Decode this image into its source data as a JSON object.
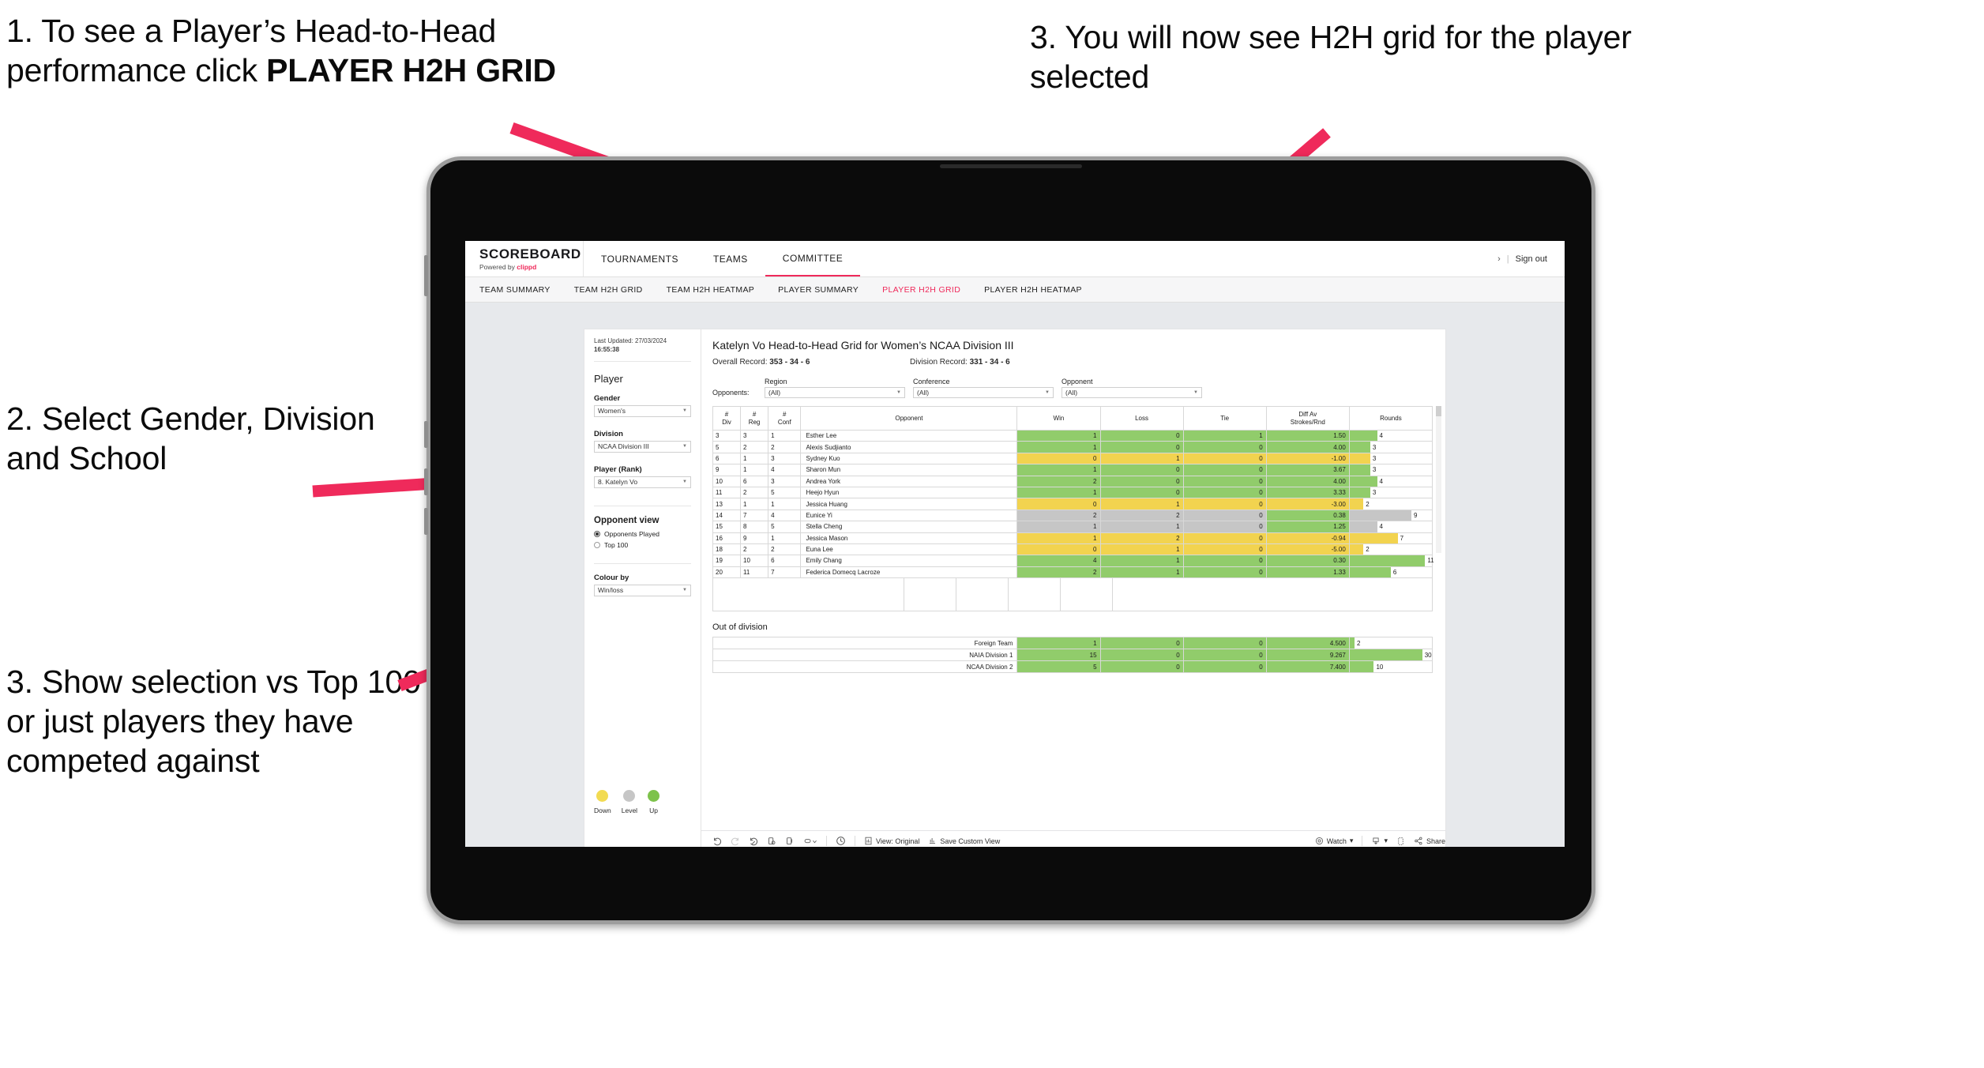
{
  "annotations": {
    "step1_prefix": "1. To see a Player’s Head-to-Head performance click ",
    "step1_bold": "PLAYER H2H GRID",
    "step2": "2. Select Gender, Division and School",
    "step3_left": "3. Show selection vs Top 100 or just players they have competed against",
    "step3_right": "3. You will now see H2H grid for the player selected",
    "arrow_color": "#EF2A5B"
  },
  "app": {
    "logo": {
      "title": "SCOREBOARD",
      "powered_prefix": "Powered by ",
      "brand": "clippd"
    },
    "topnav": [
      {
        "label": "TOURNAMENTS",
        "active": false
      },
      {
        "label": "TEAMS",
        "active": false
      },
      {
        "label": "COMMITTEE",
        "active": true
      }
    ],
    "topnav_right": {
      "chevron": "›",
      "divider": "|",
      "sign_out": "Sign out"
    },
    "subnav": [
      {
        "label": "TEAM SUMMARY",
        "active": false
      },
      {
        "label": "TEAM H2H GRID",
        "active": false
      },
      {
        "label": "TEAM H2H HEATMAP",
        "active": false
      },
      {
        "label": "PLAYER SUMMARY",
        "active": false
      },
      {
        "label": "PLAYER H2H GRID",
        "active": true
      },
      {
        "label": "PLAYER H2H HEATMAP",
        "active": false
      }
    ],
    "accent": "#EF2A5B"
  },
  "pane": {
    "last_updated_label": "Last Updated: 27/03/2024",
    "last_updated_time": "16:55:38",
    "heading": "Player",
    "filters": [
      {
        "label": "Gender",
        "value": "Women's"
      },
      {
        "label": "Division",
        "value": "NCAA Division III"
      },
      {
        "label": "Player (Rank)",
        "value": "8. Katelyn Vo"
      }
    ],
    "opponent_view": {
      "heading": "Opponent view",
      "options": [
        {
          "label": "Opponents Played",
          "selected": true
        },
        {
          "label": "Top 100",
          "selected": false
        }
      ]
    },
    "colour_by": {
      "label": "Colour by",
      "value": "Win/loss"
    },
    "legend": [
      {
        "label": "Down",
        "color": "#F2DB52"
      },
      {
        "label": "Level",
        "color": "#C6C6C6"
      },
      {
        "label": "Up",
        "color": "#7DC24B"
      }
    ]
  },
  "view": {
    "title": "Katelyn Vo Head-to-Head Grid for Women’s NCAA Division III",
    "overall_label": "Overall Record: ",
    "overall_value": "353 - 34 - 6",
    "division_label": "Division Record: ",
    "division_value": "331 - 34 - 6",
    "opponents_label": "Opponents:",
    "opponent_filters": [
      {
        "caption": "Region",
        "value": "(All)"
      },
      {
        "caption": "Conference",
        "value": "(All)"
      },
      {
        "caption": "Opponent",
        "value": "(All)"
      }
    ]
  },
  "chart_data": {
    "type": "table",
    "title": "Katelyn Vo Head-to-Head Grid for Women’s NCAA Division III",
    "columns": [
      "# Div",
      "# Reg",
      "# Conf",
      "Opponent",
      "Win",
      "Loss",
      "Tie",
      "Diff Av Strokes/Rnd",
      "Rounds"
    ],
    "column_lines": [
      [
        "#",
        "Div"
      ],
      [
        "#",
        "Reg"
      ],
      [
        "#",
        "Conf"
      ],
      [
        "Opponent"
      ],
      [
        "Win"
      ],
      [
        "Loss"
      ],
      [
        "Tie"
      ],
      [
        "Diff Av",
        "Strokes/Rnd"
      ],
      [
        "Rounds"
      ]
    ],
    "rounds_max": 12,
    "rows": [
      {
        "div": "3",
        "reg": "3",
        "conf": "1",
        "opponent": "Esther Lee",
        "win": "1",
        "loss": "0",
        "tie": "1",
        "diff": "1.50",
        "rounds": "4",
        "rounds_num": 4,
        "color": "#91CC6B"
      },
      {
        "div": "5",
        "reg": "2",
        "conf": "2",
        "opponent": "Alexis Sudjianto",
        "win": "1",
        "loss": "0",
        "tie": "0",
        "diff": "4.00",
        "rounds": "3",
        "rounds_num": 3,
        "color": "#91CC6B"
      },
      {
        "div": "6",
        "reg": "1",
        "conf": "3",
        "opponent": "Sydney Kuo",
        "win": "0",
        "loss": "1",
        "tie": "0",
        "diff": "-1.00",
        "rounds": "3",
        "rounds_num": 3,
        "color": "#F2D34F"
      },
      {
        "div": "9",
        "reg": "1",
        "conf": "4",
        "opponent": "Sharon Mun",
        "win": "1",
        "loss": "0",
        "tie": "0",
        "diff": "3.67",
        "rounds": "3",
        "rounds_num": 3,
        "color": "#91CC6B"
      },
      {
        "div": "10",
        "reg": "6",
        "conf": "3",
        "opponent": "Andrea York",
        "win": "2",
        "loss": "0",
        "tie": "0",
        "diff": "4.00",
        "rounds": "4",
        "rounds_num": 4,
        "color": "#91CC6B"
      },
      {
        "div": "11",
        "reg": "2",
        "conf": "5",
        "opponent": "Heejo Hyun",
        "win": "1",
        "loss": "0",
        "tie": "0",
        "diff": "3.33",
        "rounds": "3",
        "rounds_num": 3,
        "color": "#91CC6B"
      },
      {
        "div": "13",
        "reg": "1",
        "conf": "1",
        "opponent": "Jessica Huang",
        "win": "0",
        "loss": "1",
        "tie": "0",
        "diff": "-3.00",
        "rounds": "2",
        "rounds_num": 2,
        "color": "#F2D34F"
      },
      {
        "div": "14",
        "reg": "7",
        "conf": "4",
        "opponent": "Eunice Yi",
        "win": "2",
        "loss": "2",
        "tie": "0",
        "diff": "0.38",
        "rounds": "9",
        "rounds_num": 9,
        "color": "#C6C6C6",
        "diff_color": "#91CC6B"
      },
      {
        "div": "15",
        "reg": "8",
        "conf": "5",
        "opponent": "Stella Cheng",
        "win": "1",
        "loss": "1",
        "tie": "0",
        "diff": "1.25",
        "rounds": "4",
        "rounds_num": 4,
        "color": "#C6C6C6",
        "diff_color": "#91CC6B"
      },
      {
        "div": "16",
        "reg": "9",
        "conf": "1",
        "opponent": "Jessica Mason",
        "win": "1",
        "loss": "2",
        "tie": "0",
        "diff": "-0.94",
        "rounds": "7",
        "rounds_num": 7,
        "color": "#F2D34F"
      },
      {
        "div": "18",
        "reg": "2",
        "conf": "2",
        "opponent": "Euna Lee",
        "win": "0",
        "loss": "1",
        "tie": "0",
        "diff": "-5.00",
        "rounds": "2",
        "rounds_num": 2,
        "color": "#F2D34F"
      },
      {
        "div": "19",
        "reg": "10",
        "conf": "6",
        "opponent": "Emily Chang",
        "win": "4",
        "loss": "1",
        "tie": "0",
        "diff": "0.30",
        "rounds": "11",
        "rounds_num": 11,
        "color": "#91CC6B"
      },
      {
        "div": "20",
        "reg": "11",
        "conf": "7",
        "opponent": "Federica Domecq Lacroze",
        "win": "2",
        "loss": "1",
        "tie": "0",
        "diff": "1.33",
        "rounds": "6",
        "rounds_num": 6,
        "color": "#91CC6B"
      }
    ]
  },
  "out_of_division": {
    "heading": "Out of division",
    "rounds_max": 34,
    "rows": [
      {
        "label": "Foreign Team",
        "win": "1",
        "loss": "0",
        "tie": "0",
        "diff": "4.500",
        "rounds": "2",
        "rounds_num": 2,
        "color": "#91CC6B"
      },
      {
        "label": "NAIA Division 1",
        "win": "15",
        "loss": "0",
        "tie": "0",
        "diff": "9.267",
        "rounds": "30",
        "rounds_num": 30,
        "color": "#91CC6B"
      },
      {
        "label": "NCAA Division 2",
        "win": "5",
        "loss": "0",
        "tie": "0",
        "diff": "7.400",
        "rounds": "10",
        "rounds_num": 10,
        "color": "#91CC6B"
      }
    ]
  },
  "toolbar": {
    "view_original": "View: Original",
    "save_custom_view": "Save Custom View",
    "watch": "Watch",
    "share": "Share",
    "caret": "▾"
  }
}
